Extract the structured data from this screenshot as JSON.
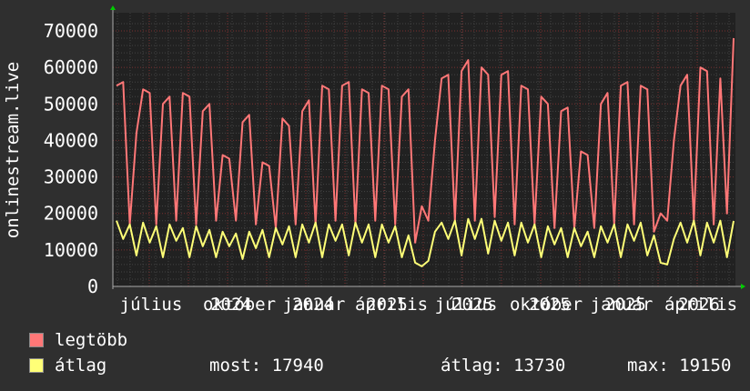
{
  "chart_data": {
    "type": "line",
    "ylabel": "onlinestream.live",
    "ylim": [
      0,
      70000
    ],
    "yticks": [
      "0",
      "10000",
      "20000",
      "30000",
      "40000",
      "50000",
      "60000",
      "70000"
    ],
    "xtick_months": [
      "július",
      "október",
      "január",
      "április",
      "július",
      "október",
      "január",
      "április"
    ],
    "xtick_years": [
      "2024",
      "2024",
      "2025",
      "2025",
      "2025",
      "2025",
      "2026"
    ],
    "grid": true,
    "colors": {
      "background": "#2f2f2f",
      "plot": "#212121",
      "grid": "#6a2a2a",
      "max": "#ff7777",
      "avg": "#ffff77"
    },
    "series": [
      {
        "name": "legtöbb",
        "color": "#ff7777",
        "values": [
          55000,
          56000,
          17000,
          42000,
          54000,
          53000,
          17000,
          50000,
          52000,
          18000,
          53000,
          52000,
          17000,
          48000,
          50000,
          18000,
          36000,
          35000,
          18000,
          45000,
          47000,
          17000,
          34000,
          33000,
          16000,
          46000,
          44000,
          17000,
          48000,
          51000,
          17000,
          55000,
          54000,
          18000,
          55000,
          56000,
          17000,
          54000,
          53000,
          18000,
          55000,
          54000,
          17000,
          52000,
          54000,
          12000,
          22000,
          18000,
          40000,
          57000,
          58000,
          18000,
          59000,
          62000,
          18000,
          60000,
          58000,
          19000,
          58000,
          59000,
          17000,
          55000,
          54000,
          17000,
          52000,
          50000,
          16000,
          48000,
          49000,
          16000,
          37000,
          36000,
          16000,
          50000,
          53000,
          17000,
          55000,
          56000,
          17000,
          55000,
          54000,
          15000,
          20000,
          18000,
          40000,
          55000,
          58000,
          18000,
          60000,
          59000,
          17000,
          57000,
          20000,
          68000
        ]
      },
      {
        "name": "átlag",
        "color": "#ffff77",
        "values": [
          18000,
          13000,
          17000,
          8500,
          17500,
          12000,
          16500,
          8000,
          17000,
          12500,
          16000,
          8000,
          16500,
          11000,
          15500,
          8000,
          15000,
          11000,
          14500,
          7500,
          15000,
          10500,
          15500,
          8000,
          16000,
          11500,
          16500,
          8000,
          17000,
          12000,
          17500,
          8000,
          17000,
          12500,
          17000,
          8500,
          17500,
          12000,
          17000,
          8000,
          17000,
          12000,
          16500,
          8000,
          14000,
          6500,
          5500,
          7000,
          15000,
          17500,
          13000,
          18000,
          8500,
          18500,
          13000,
          18500,
          9000,
          18000,
          12500,
          17500,
          8500,
          17500,
          12000,
          17000,
          8000,
          16500,
          11500,
          16000,
          8000,
          16000,
          11000,
          15000,
          8000,
          16500,
          12000,
          17000,
          8000,
          17000,
          12500,
          17500,
          8500,
          14000,
          6500,
          6000,
          13000,
          17500,
          12000,
          18000,
          8500,
          17500,
          12000,
          18000,
          8000,
          17940
        ]
      }
    ]
  },
  "legend": {
    "max_label": "legtöbb",
    "avg_label": "átlag",
    "now": "most: 17940",
    "avg": "átlag: 13730",
    "max": "max: 19150"
  }
}
